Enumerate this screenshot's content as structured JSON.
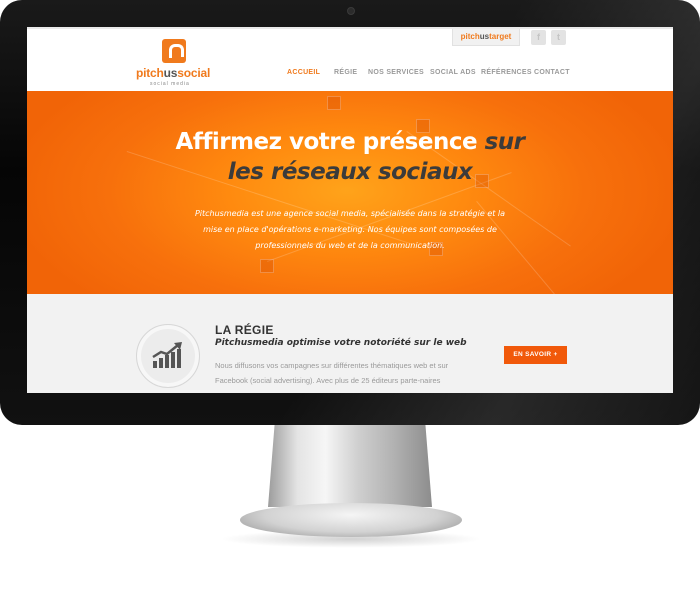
{
  "brand": {
    "name_part1": "pitch",
    "name_part2": "us",
    "name_part3": "social",
    "tagline": "social media",
    "accent_color": "#f07a1d"
  },
  "top_links": {
    "pitchustarget_part1": "pitch",
    "pitchustarget_part2": "us",
    "pitchustarget_part3": "target",
    "facebook_glyph": "f",
    "twitter_glyph": "t"
  },
  "nav": {
    "items": [
      {
        "label": "ACCUEIL",
        "active": true
      },
      {
        "label": "RÉGIE",
        "active": false
      },
      {
        "label": "NOS SERVICES",
        "active": false
      },
      {
        "label": "SOCIAL ADS",
        "active": false
      },
      {
        "label": "RÉFÉRENCES",
        "active": false
      },
      {
        "label": "CONTACT",
        "active": false
      }
    ]
  },
  "hero": {
    "title_line1": "Affirmez votre présence ",
    "title_line1_em": "sur",
    "title_line2": "les réseaux sociaux",
    "text": "Pitchusmedia est une agence social media, spécialisée dans la stratégie et la mise en place d'opérations e-marketing. Nos équipes sont composées de professionnels du web et de la communication."
  },
  "regie": {
    "icon": "growth-chart-icon",
    "title": "LA RÉGIE",
    "subtitle": "Pitchusmedia optimise votre notoriété sur le web",
    "text": "Nous diffusons vos campagnes sur différentes thématiques web et sur Facebook (social advertising). Avec plus de 25 éditeurs parte-naires",
    "cta_label": "EN SAVOIR +",
    "cta_color": "#f1590a"
  }
}
